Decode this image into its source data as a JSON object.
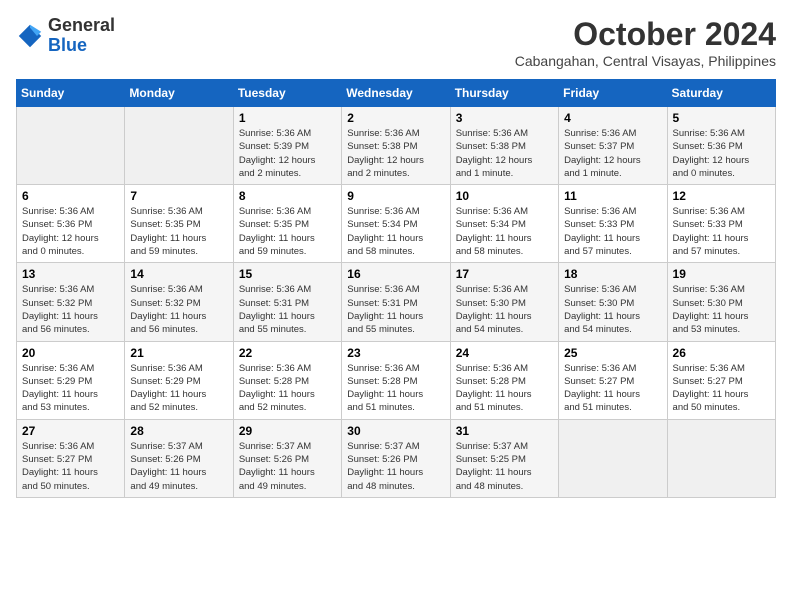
{
  "logo": {
    "text_general": "General",
    "text_blue": "Blue"
  },
  "header": {
    "month": "October 2024",
    "location": "Cabangahan, Central Visayas, Philippines"
  },
  "weekdays": [
    "Sunday",
    "Monday",
    "Tuesday",
    "Wednesday",
    "Thursday",
    "Friday",
    "Saturday"
  ],
  "weeks": [
    [
      {
        "day": "",
        "info": ""
      },
      {
        "day": "",
        "info": ""
      },
      {
        "day": "1",
        "info": "Sunrise: 5:36 AM\nSunset: 5:39 PM\nDaylight: 12 hours\nand 2 minutes."
      },
      {
        "day": "2",
        "info": "Sunrise: 5:36 AM\nSunset: 5:38 PM\nDaylight: 12 hours\nand 2 minutes."
      },
      {
        "day": "3",
        "info": "Sunrise: 5:36 AM\nSunset: 5:38 PM\nDaylight: 12 hours\nand 1 minute."
      },
      {
        "day": "4",
        "info": "Sunrise: 5:36 AM\nSunset: 5:37 PM\nDaylight: 12 hours\nand 1 minute."
      },
      {
        "day": "5",
        "info": "Sunrise: 5:36 AM\nSunset: 5:36 PM\nDaylight: 12 hours\nand 0 minutes."
      }
    ],
    [
      {
        "day": "6",
        "info": "Sunrise: 5:36 AM\nSunset: 5:36 PM\nDaylight: 12 hours\nand 0 minutes."
      },
      {
        "day": "7",
        "info": "Sunrise: 5:36 AM\nSunset: 5:35 PM\nDaylight: 11 hours\nand 59 minutes."
      },
      {
        "day": "8",
        "info": "Sunrise: 5:36 AM\nSunset: 5:35 PM\nDaylight: 11 hours\nand 59 minutes."
      },
      {
        "day": "9",
        "info": "Sunrise: 5:36 AM\nSunset: 5:34 PM\nDaylight: 11 hours\nand 58 minutes."
      },
      {
        "day": "10",
        "info": "Sunrise: 5:36 AM\nSunset: 5:34 PM\nDaylight: 11 hours\nand 58 minutes."
      },
      {
        "day": "11",
        "info": "Sunrise: 5:36 AM\nSunset: 5:33 PM\nDaylight: 11 hours\nand 57 minutes."
      },
      {
        "day": "12",
        "info": "Sunrise: 5:36 AM\nSunset: 5:33 PM\nDaylight: 11 hours\nand 57 minutes."
      }
    ],
    [
      {
        "day": "13",
        "info": "Sunrise: 5:36 AM\nSunset: 5:32 PM\nDaylight: 11 hours\nand 56 minutes."
      },
      {
        "day": "14",
        "info": "Sunrise: 5:36 AM\nSunset: 5:32 PM\nDaylight: 11 hours\nand 56 minutes."
      },
      {
        "day": "15",
        "info": "Sunrise: 5:36 AM\nSunset: 5:31 PM\nDaylight: 11 hours\nand 55 minutes."
      },
      {
        "day": "16",
        "info": "Sunrise: 5:36 AM\nSunset: 5:31 PM\nDaylight: 11 hours\nand 55 minutes."
      },
      {
        "day": "17",
        "info": "Sunrise: 5:36 AM\nSunset: 5:30 PM\nDaylight: 11 hours\nand 54 minutes."
      },
      {
        "day": "18",
        "info": "Sunrise: 5:36 AM\nSunset: 5:30 PM\nDaylight: 11 hours\nand 54 minutes."
      },
      {
        "day": "19",
        "info": "Sunrise: 5:36 AM\nSunset: 5:30 PM\nDaylight: 11 hours\nand 53 minutes."
      }
    ],
    [
      {
        "day": "20",
        "info": "Sunrise: 5:36 AM\nSunset: 5:29 PM\nDaylight: 11 hours\nand 53 minutes."
      },
      {
        "day": "21",
        "info": "Sunrise: 5:36 AM\nSunset: 5:29 PM\nDaylight: 11 hours\nand 52 minutes."
      },
      {
        "day": "22",
        "info": "Sunrise: 5:36 AM\nSunset: 5:28 PM\nDaylight: 11 hours\nand 52 minutes."
      },
      {
        "day": "23",
        "info": "Sunrise: 5:36 AM\nSunset: 5:28 PM\nDaylight: 11 hours\nand 51 minutes."
      },
      {
        "day": "24",
        "info": "Sunrise: 5:36 AM\nSunset: 5:28 PM\nDaylight: 11 hours\nand 51 minutes."
      },
      {
        "day": "25",
        "info": "Sunrise: 5:36 AM\nSunset: 5:27 PM\nDaylight: 11 hours\nand 51 minutes."
      },
      {
        "day": "26",
        "info": "Sunrise: 5:36 AM\nSunset: 5:27 PM\nDaylight: 11 hours\nand 50 minutes."
      }
    ],
    [
      {
        "day": "27",
        "info": "Sunrise: 5:36 AM\nSunset: 5:27 PM\nDaylight: 11 hours\nand 50 minutes."
      },
      {
        "day": "28",
        "info": "Sunrise: 5:37 AM\nSunset: 5:26 PM\nDaylight: 11 hours\nand 49 minutes."
      },
      {
        "day": "29",
        "info": "Sunrise: 5:37 AM\nSunset: 5:26 PM\nDaylight: 11 hours\nand 49 minutes."
      },
      {
        "day": "30",
        "info": "Sunrise: 5:37 AM\nSunset: 5:26 PM\nDaylight: 11 hours\nand 48 minutes."
      },
      {
        "day": "31",
        "info": "Sunrise: 5:37 AM\nSunset: 5:25 PM\nDaylight: 11 hours\nand 48 minutes."
      },
      {
        "day": "",
        "info": ""
      },
      {
        "day": "",
        "info": ""
      }
    ]
  ]
}
